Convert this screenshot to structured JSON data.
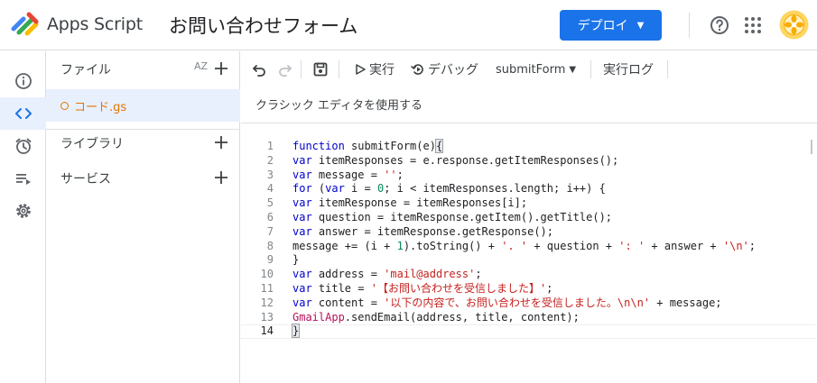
{
  "header": {
    "app_name": "Apps Script",
    "project_title": "お問い合わせフォーム",
    "deploy_label": "デプロイ",
    "accent": "#1a73e8",
    "icons": [
      "apps-script-logo-icon",
      "help-icon",
      "apps-grid-icon",
      "avatar"
    ]
  },
  "rail": {
    "items": [
      {
        "icon": "info-icon",
        "active": false
      },
      {
        "icon": "code-icon",
        "active": true
      },
      {
        "icon": "alarm-icon",
        "active": false
      },
      {
        "icon": "executions-icon",
        "active": false
      },
      {
        "icon": "settings-icon",
        "active": false
      }
    ]
  },
  "files": {
    "files_label": "ファイル",
    "sort_label": "AZ",
    "file_name": "コード.gs",
    "libraries_label": "ライブラリ",
    "services_label": "サービス"
  },
  "toolbar": {
    "run_label": "実行",
    "debug_label": "デバッグ",
    "function_select": "submitForm",
    "log_label": "実行ログ"
  },
  "editor": {
    "classic_link": "クラシック エディタを使用する",
    "current_line": 14,
    "lines": [
      "function submitForm(e){",
      "var itemResponses = e.response.getItemResponses();",
      "var message = '';",
      "for (var i = 0; i < itemResponses.length; i++) {",
      "var itemResponse = itemResponses[i];",
      "var question = itemResponse.getItem().getTitle();",
      "var answer = itemResponse.getResponse();",
      "message += (i + 1).toString() + '. ' + question + ': ' + answer + '\\n';",
      "}",
      "var address = 'mail@address';",
      "var title = '【お問い合わせを受信しました】';",
      "var content = '以下の内容で、お問い合わせを受信しました。\\n\\n' + message;",
      "GmailApp.sendEmail(address, title, content);",
      "}"
    ]
  }
}
